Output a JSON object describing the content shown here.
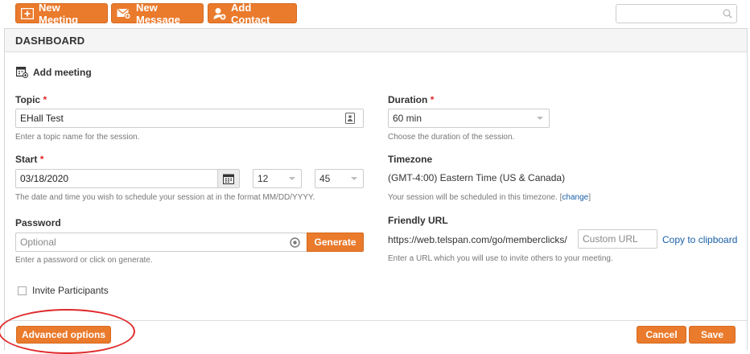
{
  "toolbar": {
    "new_meeting": "New Meeting",
    "new_message": "New Message",
    "add_contact": "Add Contact",
    "search_placeholder": ""
  },
  "dashboard": {
    "title": "DASHBOARD",
    "subtitle": "Add meeting"
  },
  "form": {
    "topic": {
      "label": "Topic",
      "required_mark": "*",
      "value": "EHall Test",
      "help": "Enter a topic name for the session."
    },
    "duration": {
      "label": "Duration",
      "required_mark": "*",
      "value": "60 min",
      "help": "Choose the duration of the session."
    },
    "start": {
      "label": "Start",
      "required_mark": "*",
      "date": "03/18/2020",
      "hour": "12",
      "minute": "45",
      "help": "The date and time you wish to schedule your session at in the format MM/DD/YYYY."
    },
    "timezone": {
      "label": "Timezone",
      "value": "(GMT-4:00) Eastern Time (US & Canada)",
      "help_prefix": "Your session will be scheduled in this timezone. [",
      "help_link": "change",
      "help_suffix": "]"
    },
    "password": {
      "label": "Password",
      "placeholder": "Optional",
      "generate": "Generate",
      "help": "Enter a password or click on generate."
    },
    "friendly_url": {
      "label": "Friendly URL",
      "prefix": "https://web.telspan.com/go/memberclicks/",
      "placeholder": "Custom URL",
      "copy": "Copy to clipboard",
      "help": "Enter a URL which you will use to invite others to your meeting."
    },
    "invite": {
      "label": "Invite Participants",
      "checked": false
    }
  },
  "footer": {
    "advanced": "Advanced options",
    "cancel": "Cancel",
    "save": "Save"
  },
  "colors": {
    "accent": "#ea7a2c",
    "required": "#e0292a",
    "link": "#1a5fa8",
    "highlight_ellipse": "#e0292a"
  }
}
